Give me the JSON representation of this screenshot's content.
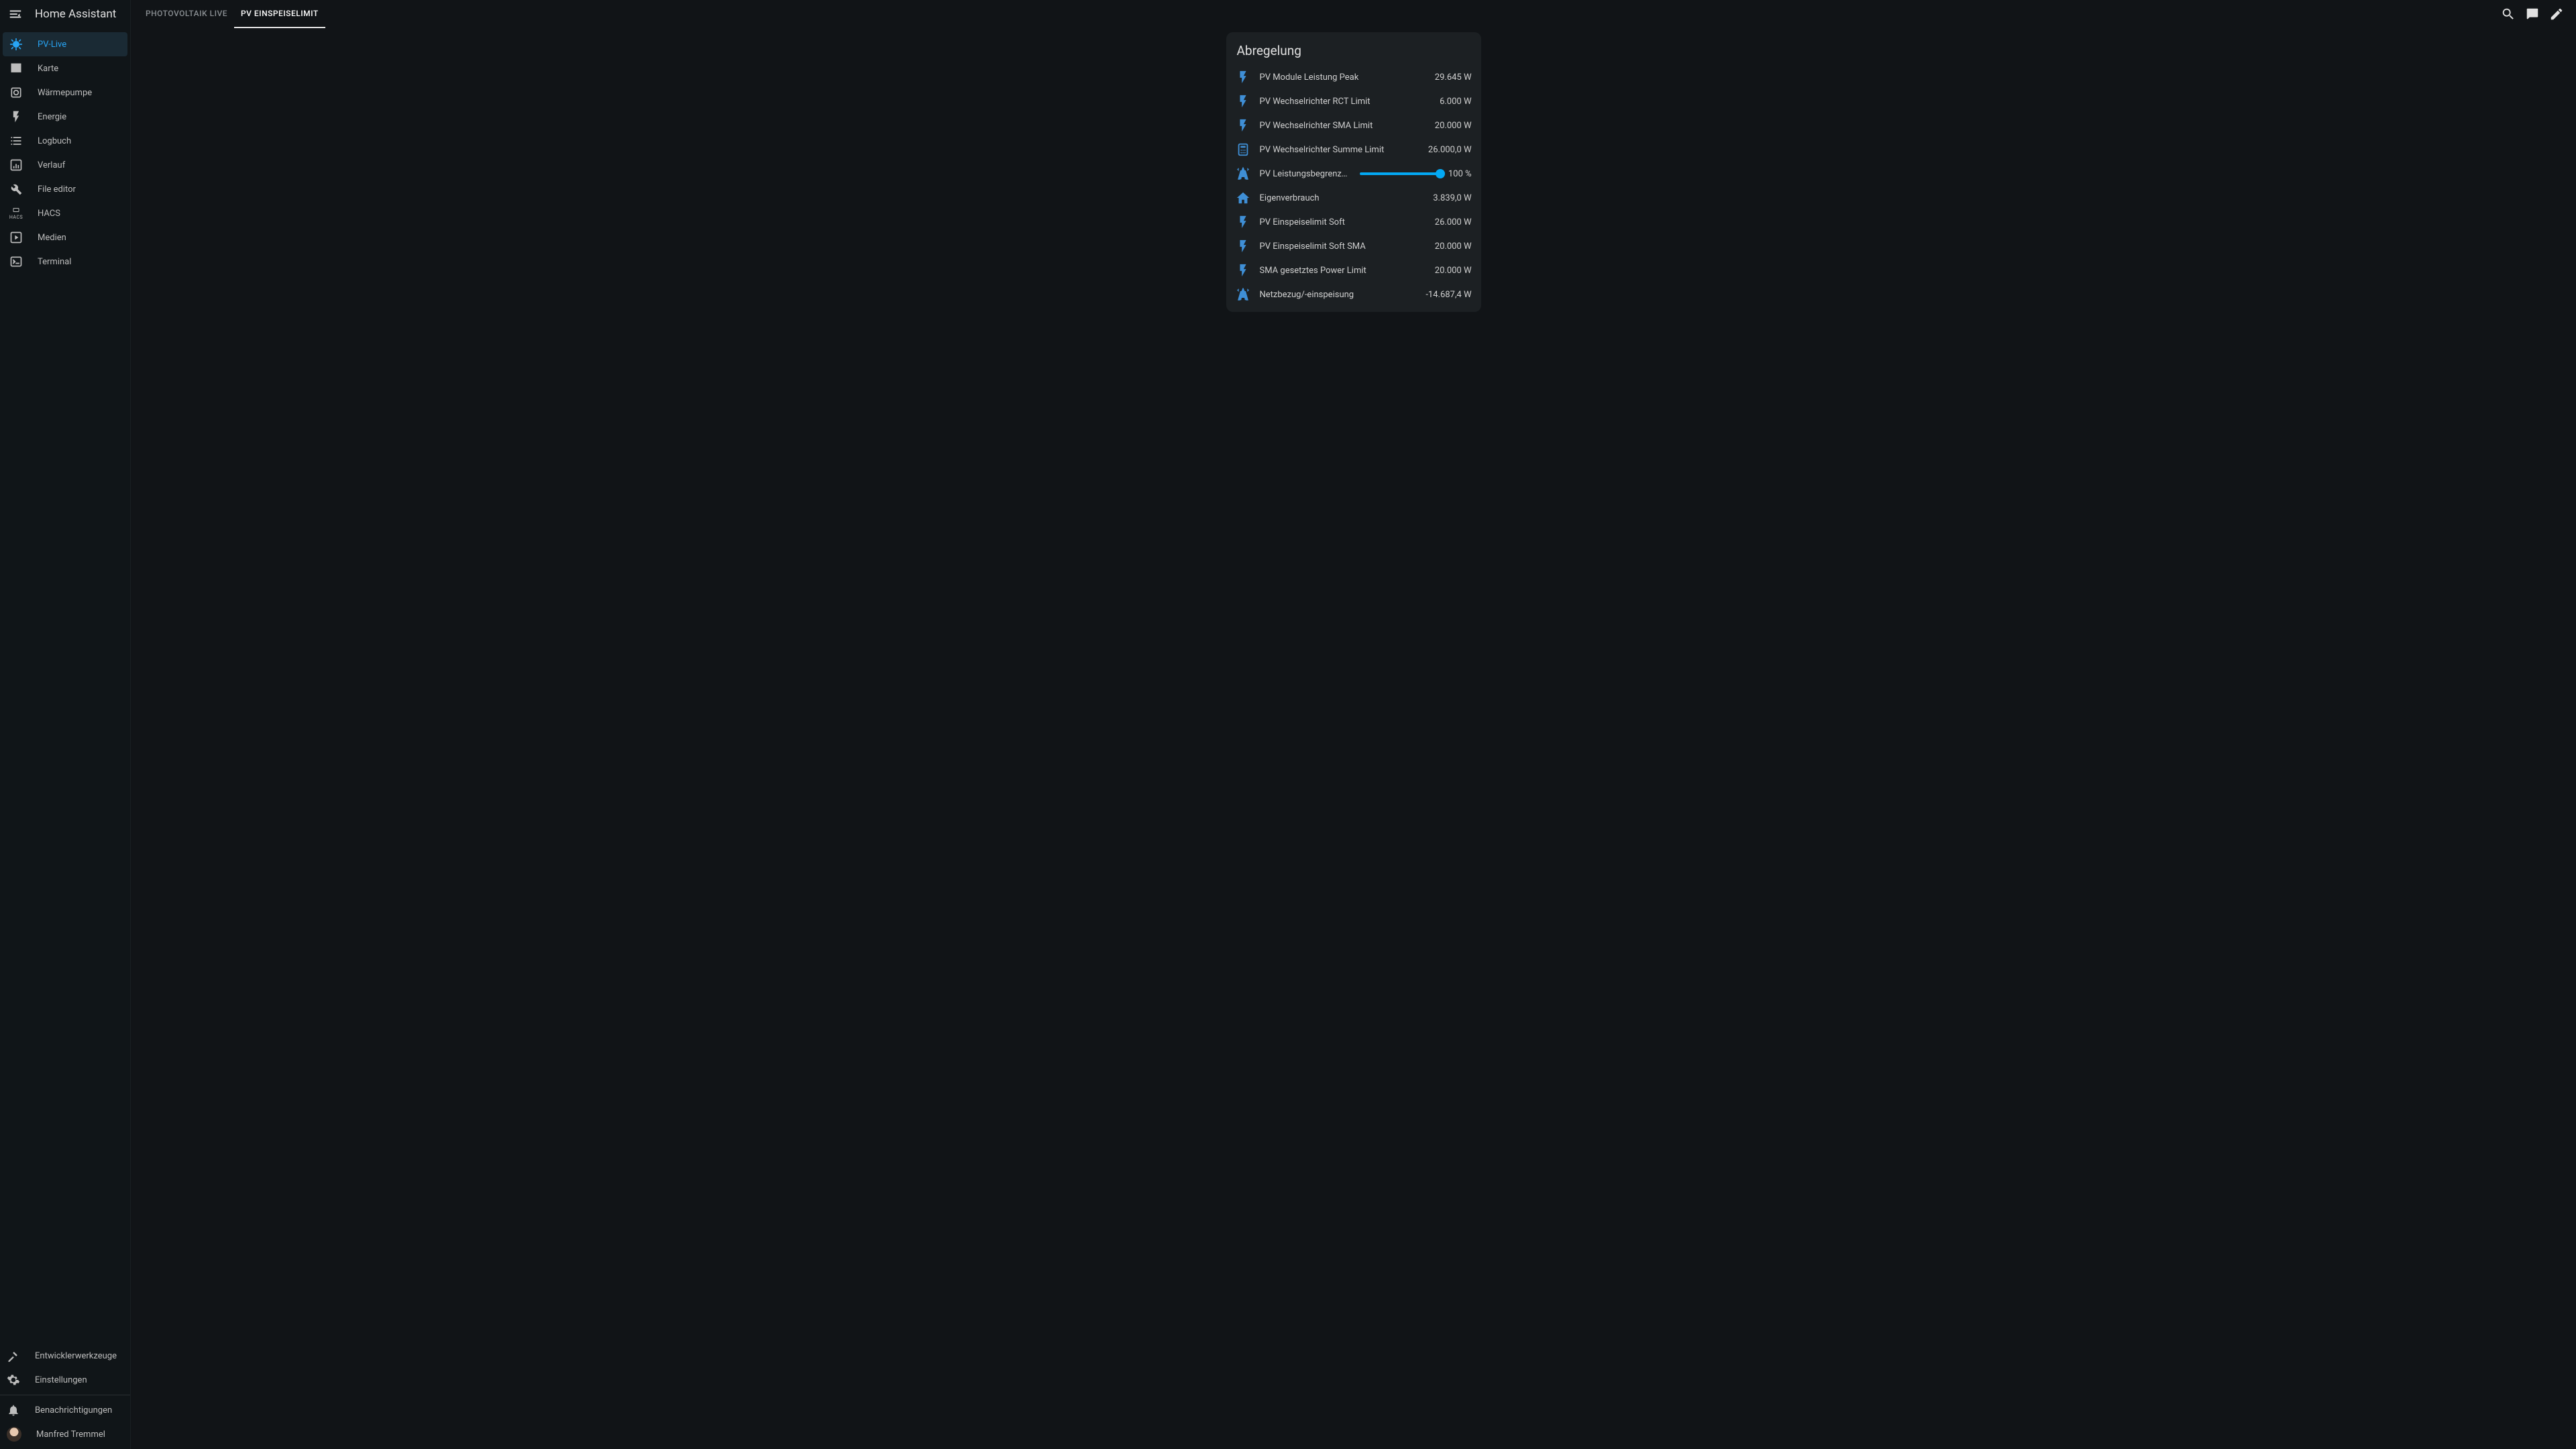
{
  "app_title": "Home Assistant",
  "sidebar": {
    "items": [
      {
        "label": "PV-Live",
        "icon": "weather-sunny-icon",
        "active": true
      },
      {
        "label": "Karte",
        "icon": "map-icon",
        "active": false
      },
      {
        "label": "Wärmepumpe",
        "icon": "hvac-icon",
        "active": false
      },
      {
        "label": "Energie",
        "icon": "flash-icon",
        "active": false
      },
      {
        "label": "Logbuch",
        "icon": "list-icon",
        "active": false
      },
      {
        "label": "Verlauf",
        "icon": "chart-box-icon",
        "active": false
      },
      {
        "label": "File editor",
        "icon": "wrench-icon",
        "active": false
      },
      {
        "label": "HACS",
        "icon": "hacs-icon",
        "active": false
      },
      {
        "label": "Medien",
        "icon": "play-box-icon",
        "active": false
      },
      {
        "label": "Terminal",
        "icon": "console-icon",
        "active": false
      }
    ],
    "bottom": [
      {
        "label": "Entwicklerwerkzeuge",
        "icon": "hammer-icon"
      },
      {
        "label": "Einstellungen",
        "icon": "cog-icon"
      }
    ],
    "notifications_label": "Benachrichtigungen",
    "user_name": "Manfred Tremmel"
  },
  "tabs": [
    {
      "label": "PHOTOVOLTAIK LIVE",
      "active": false
    },
    {
      "label": "PV EINSPEISELIMIT",
      "active": true
    }
  ],
  "card": {
    "title": "Abregelung",
    "rows": [
      {
        "icon": "flash-icon",
        "label": "PV Module Leistung Peak",
        "value": "29.645 W",
        "type": "value"
      },
      {
        "icon": "flash-icon",
        "label": "PV Wechselrichter RCT Limit",
        "value": "6.000 W",
        "type": "value"
      },
      {
        "icon": "flash-icon",
        "label": "PV Wechselrichter SMA Limit",
        "value": "20.000 W",
        "type": "value"
      },
      {
        "icon": "calculator-icon",
        "label": "PV Wechselrichter Summe Limit",
        "value": "26.000,0 W",
        "type": "value"
      },
      {
        "icon": "transmission-tower-icon",
        "label": "PV Leistungsbegrenzung",
        "value": "100 %",
        "type": "slider",
        "percent": 100
      },
      {
        "icon": "home-icon",
        "label": "Eigenverbrauch",
        "value": "3.839,0 W",
        "type": "value"
      },
      {
        "icon": "flash-icon",
        "label": "PV Einspeiselimit Soft",
        "value": "26.000 W",
        "type": "value"
      },
      {
        "icon": "flash-icon",
        "label": "PV Einspeiselimit Soft SMA",
        "value": "20.000 W",
        "type": "value"
      },
      {
        "icon": "flash-icon",
        "label": "SMA gesetztes Power Limit",
        "value": "20.000 W",
        "type": "value"
      },
      {
        "icon": "transmission-tower-icon",
        "label": "Netzbezug/-einspeisung",
        "value": "-14.687,4 W",
        "type": "value"
      }
    ]
  },
  "colors": {
    "accent": "#03a9f4",
    "icon_blue": "#3f8fd6"
  }
}
